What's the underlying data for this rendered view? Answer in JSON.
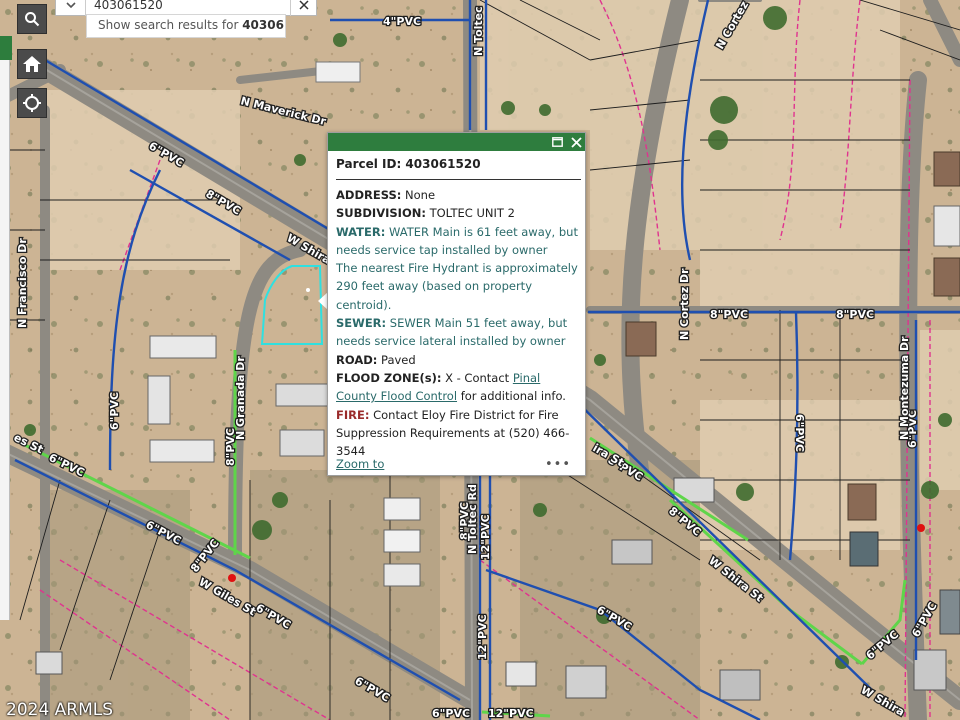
{
  "search": {
    "value": "403061520",
    "suggestion_prefix": "Show search results for ",
    "suggestion_term": "40306..."
  },
  "controls": {
    "home_icon": "home-icon",
    "locate_icon": "locate-icon"
  },
  "popup": {
    "title": "Parcel ID: 403061520",
    "address_label": "ADDRESS:",
    "address_value": "None",
    "subdivision_label": "SUBDIVISION:",
    "subdivision_value": "TOLTEC UNIT 2",
    "water_label": "WATER:",
    "water_value": "WATER Main is 61 feet away, but needs service tap installed by owner",
    "hydrant_text": "The nearest Fire Hydrant is approximately 290 feet away (based on property centroid).",
    "sewer_label": "SEWER:",
    "sewer_value": "SEWER Main 51 feet away, but needs service lateral installed by owner",
    "road_label": "ROAD:",
    "road_value": "Paved",
    "flood_label": "FLOOD ZONE(s):",
    "flood_prefix": "X - Contact",
    "flood_link": "Pinal County Flood Control",
    "flood_suffix": "for additional info.",
    "fire_label": "FIRE:",
    "fire_value": "Contact Eloy Fire District for Fire Suppression Requirements at (520) 466-3544",
    "zoom_link": "Zoom to",
    "more_label": "•••"
  },
  "map_labels": {
    "pipe_4_pvc": "4\"PVC",
    "pipe_6_pvc": "6\"PVC",
    "pipe_8_pvc": "8\"PVC",
    "pipe_12_pvc": "12\"PVC",
    "street_maverick": "N Maverick Dr",
    "street_toltec": "N Toltec",
    "street_toltec_rd": "N Toltec Rd",
    "street_cortez_top": "N Cortez",
    "street_cortez": "N Cortez Dr",
    "street_francisco": "N Francisco Dr",
    "street_granada": "N Granada Dr",
    "street_shira": "W Shira",
    "street_shira_st": "W Shira St",
    "street_shira_mid": "ira St",
    "street_giles": "W Giles St",
    "street_giles_left": "es St",
    "street_montezuma": "N Montezuma Dr",
    "street_6pvc_vertical": "6\"PVC"
  },
  "copyright": "2024 ARMLS",
  "colors": {
    "popup_header": "#2e7d3e",
    "water_line": "#1f4fb0",
    "sewer_line": "#5fd54a",
    "parcel_boundary": "#e0338f",
    "selected_parcel": "#2fe0e0",
    "hydrant": "#e01010"
  }
}
